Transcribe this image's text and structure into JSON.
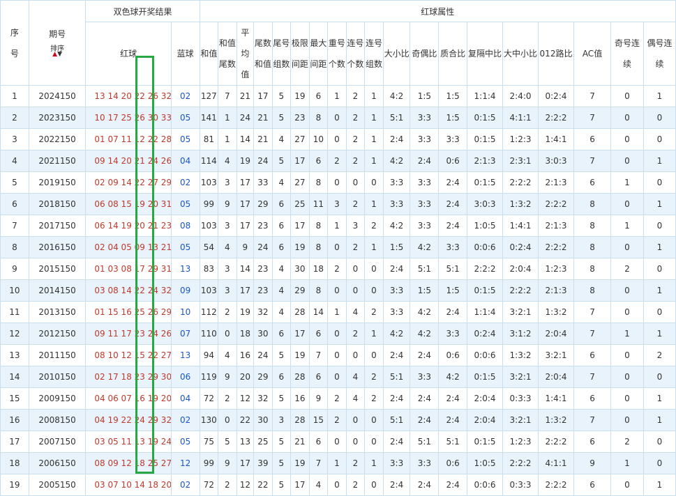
{
  "header": {
    "xuhao": "序号",
    "qihao": "期号",
    "sort_label": "排序",
    "kaijiang": "双色球开奖结果",
    "hongqiu_shuxing": "红球属性",
    "hongqiu": "红球",
    "lanqiu": "蓝球",
    "cols": [
      "和值",
      "和值尾数",
      "平均值",
      "尾数和值",
      "尾号组数",
      "极限间距",
      "最大间距",
      "重号个数",
      "连号个数",
      "连号组数",
      "大小比",
      "奇偶比",
      "质合比",
      "复隔中比",
      "大中小比",
      "012路比",
      "AC值",
      "奇号连续",
      "偶号连续"
    ]
  },
  "colors": {
    "red_text": "#c0392b",
    "blue_text": "#1a56c8",
    "row_alt_bg": "#e8f3fb",
    "border": "#c9dff0",
    "highlight": "#28a745"
  },
  "rows": [
    [
      "1",
      "2024150",
      "13 14 20 22 26 32",
      "02",
      "127",
      "7",
      "21",
      "17",
      "5",
      "19",
      "6",
      "1",
      "2",
      "1",
      "4:2",
      "1:5",
      "1:5",
      "1:1:4",
      "2:4:0",
      "0:2:4",
      "7",
      "0",
      "1"
    ],
    [
      "2",
      "2023150",
      "10 17 25 26 30 33",
      "05",
      "141",
      "1",
      "24",
      "21",
      "5",
      "23",
      "8",
      "0",
      "2",
      "1",
      "5:1",
      "3:3",
      "1:5",
      "0:1:5",
      "4:1:1",
      "2:2:2",
      "7",
      "0",
      "0"
    ],
    [
      "3",
      "2022150",
      "01 07 11 12 22 28",
      "05",
      "81",
      "1",
      "14",
      "21",
      "4",
      "27",
      "10",
      "0",
      "2",
      "1",
      "2:4",
      "3:3",
      "3:3",
      "0:1:5",
      "1:2:3",
      "1:4:1",
      "6",
      "0",
      "0"
    ],
    [
      "4",
      "2021150",
      "09 14 20 21 24 26",
      "04",
      "114",
      "4",
      "19",
      "24",
      "5",
      "17",
      "6",
      "2",
      "2",
      "1",
      "4:2",
      "2:4",
      "0:6",
      "2:1:3",
      "2:3:1",
      "3:0:3",
      "7",
      "0",
      "1"
    ],
    [
      "5",
      "2019150",
      "02 09 14 22 27 29",
      "02",
      "103",
      "3",
      "17",
      "33",
      "4",
      "27",
      "8",
      "0",
      "0",
      "0",
      "3:3",
      "3:3",
      "2:4",
      "0:1:5",
      "2:2:2",
      "2:1:3",
      "6",
      "1",
      "0"
    ],
    [
      "6",
      "2018150",
      "06 08 15 19 20 31",
      "05",
      "99",
      "9",
      "17",
      "29",
      "6",
      "25",
      "11",
      "3",
      "2",
      "1",
      "3:3",
      "3:3",
      "2:4",
      "3:0:3",
      "1:3:2",
      "2:2:2",
      "8",
      "0",
      "1"
    ],
    [
      "7",
      "2017150",
      "06 14 19 20 21 23",
      "08",
      "103",
      "3",
      "17",
      "23",
      "6",
      "17",
      "8",
      "1",
      "3",
      "2",
      "4:2",
      "3:3",
      "2:4",
      "1:0:5",
      "1:4:1",
      "2:1:3",
      "8",
      "1",
      "0"
    ],
    [
      "8",
      "2016150",
      "02 04 05 09 13 21",
      "05",
      "54",
      "4",
      "9",
      "24",
      "6",
      "19",
      "8",
      "0",
      "2",
      "1",
      "1:5",
      "4:2",
      "3:3",
      "0:0:6",
      "0:2:4",
      "2:2:2",
      "8",
      "0",
      "1"
    ],
    [
      "9",
      "2015150",
      "01 03 08 17 29 31",
      "13",
      "83",
      "3",
      "14",
      "23",
      "4",
      "30",
      "18",
      "2",
      "0",
      "0",
      "2:4",
      "5:1",
      "5:1",
      "2:2:2",
      "2:0:4",
      "1:2:3",
      "8",
      "2",
      "0"
    ],
    [
      "10",
      "2014150",
      "03 08 14 22 24 32",
      "09",
      "103",
      "3",
      "17",
      "23",
      "4",
      "29",
      "8",
      "0",
      "0",
      "0",
      "3:3",
      "1:5",
      "1:5",
      "0:1:5",
      "2:2:2",
      "2:1:3",
      "8",
      "0",
      "1"
    ],
    [
      "11",
      "2013150",
      "01 15 16 25 26 29",
      "10",
      "112",
      "2",
      "19",
      "32",
      "4",
      "28",
      "14",
      "1",
      "4",
      "2",
      "3:3",
      "4:2",
      "2:4",
      "1:1:4",
      "3:2:1",
      "1:3:2",
      "7",
      "0",
      "0"
    ],
    [
      "12",
      "2012150",
      "09 11 17 23 24 26",
      "07",
      "110",
      "0",
      "18",
      "30",
      "6",
      "17",
      "6",
      "0",
      "2",
      "1",
      "4:2",
      "4:2",
      "3:3",
      "0:2:4",
      "3:1:2",
      "2:0:4",
      "7",
      "1",
      "1"
    ],
    [
      "13",
      "2011150",
      "08 10 12 15 22 27",
      "13",
      "94",
      "4",
      "16",
      "24",
      "5",
      "19",
      "7",
      "0",
      "0",
      "0",
      "2:4",
      "2:4",
      "0:6",
      "0:0:6",
      "1:3:2",
      "3:2:1",
      "6",
      "0",
      "2"
    ],
    [
      "14",
      "2010150",
      "02 17 18 23 29 30",
      "06",
      "119",
      "9",
      "20",
      "29",
      "6",
      "28",
      "6",
      "0",
      "4",
      "2",
      "5:1",
      "3:3",
      "4:2",
      "0:1:5",
      "3:2:1",
      "2:0:4",
      "7",
      "0",
      "0"
    ],
    [
      "15",
      "2009150",
      "04 06 07 16 19 20",
      "04",
      "72",
      "2",
      "12",
      "32",
      "5",
      "16",
      "9",
      "2",
      "4",
      "2",
      "2:4",
      "2:4",
      "2:4",
      "2:0:4",
      "0:3:3",
      "1:4:1",
      "6",
      "0",
      "1"
    ],
    [
      "16",
      "2008150",
      "04 19 22 24 29 32",
      "02",
      "130",
      "0",
      "22",
      "30",
      "3",
      "28",
      "15",
      "2",
      "0",
      "0",
      "5:1",
      "2:4",
      "2:4",
      "2:0:4",
      "3:2:1",
      "1:3:2",
      "7",
      "0",
      "1"
    ],
    [
      "17",
      "2007150",
      "03 05 11 13 19 24",
      "05",
      "75",
      "5",
      "13",
      "25",
      "5",
      "21",
      "6",
      "0",
      "0",
      "0",
      "2:4",
      "5:1",
      "5:1",
      "0:1:5",
      "1:2:3",
      "2:2:2",
      "6",
      "2",
      "0"
    ],
    [
      "18",
      "2006150",
      "08 09 12 18 25 27",
      "12",
      "99",
      "9",
      "17",
      "39",
      "5",
      "19",
      "7",
      "1",
      "2",
      "1",
      "3:3",
      "3:3",
      "0:6",
      "1:0:5",
      "2:2:2",
      "4:1:1",
      "9",
      "1",
      "0"
    ],
    [
      "19",
      "2005150",
      "03 07 10 14 18 20",
      "02",
      "72",
      "2",
      "12",
      "22",
      "5",
      "17",
      "4",
      "0",
      "2",
      "0",
      "2:4",
      "2:4",
      "2:4",
      "0:0:6",
      "0:3:3",
      "2:2:2",
      "6",
      "0",
      "1"
    ]
  ]
}
